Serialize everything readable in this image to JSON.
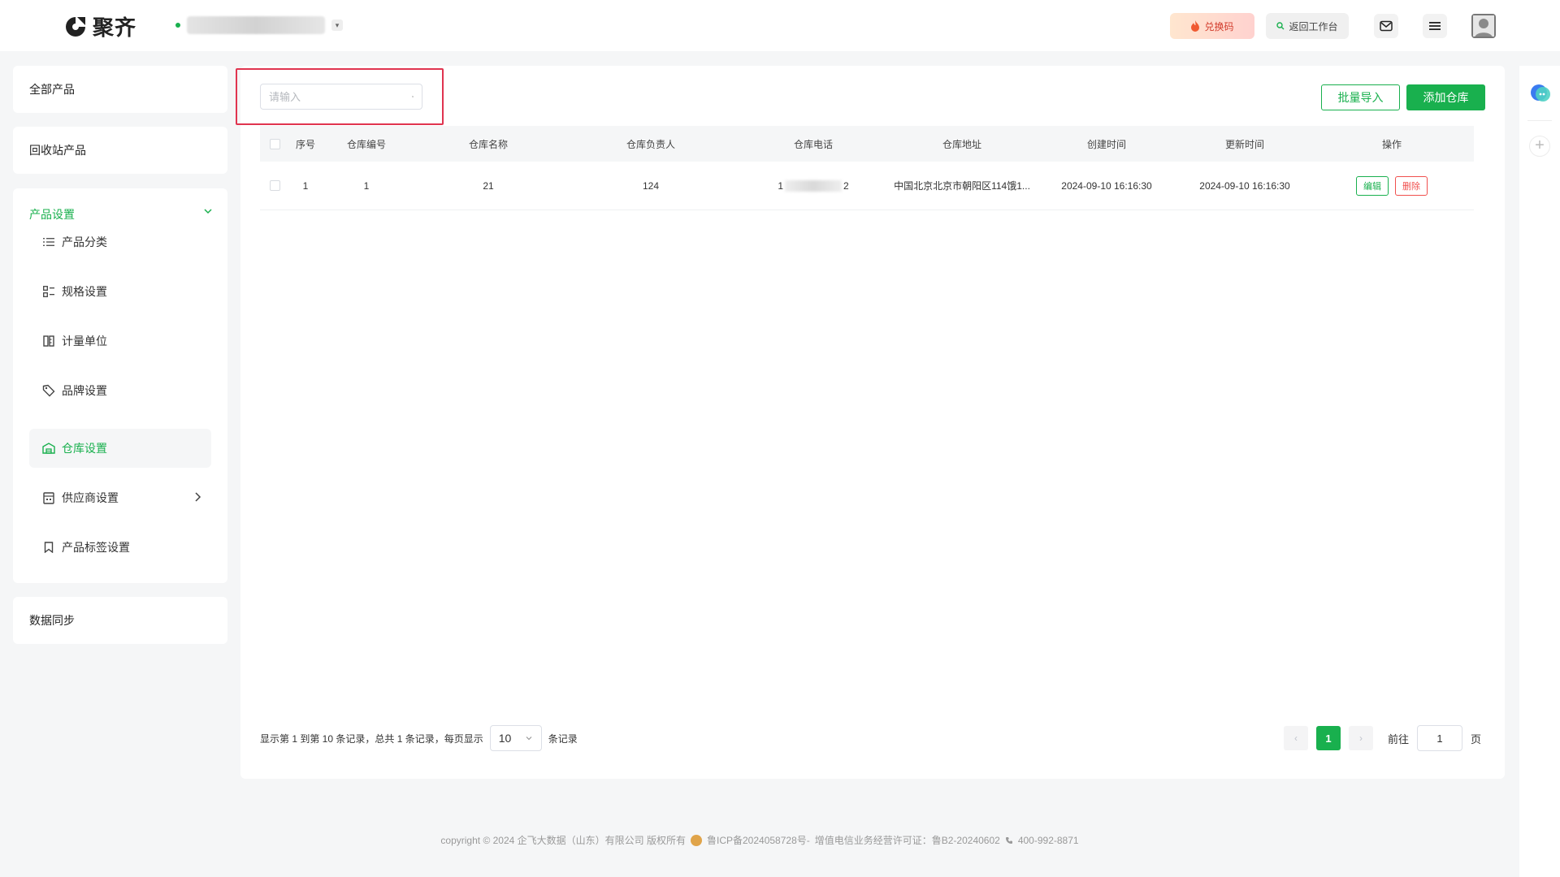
{
  "app": {
    "name": "聚齐",
    "brand_color": "#19b04e"
  },
  "header": {
    "redeem_label": "兑换码",
    "back_label": "返回工作台"
  },
  "sidebar": {
    "all_products": "全部产品",
    "recycle_bin": "回收站产品",
    "group_title": "产品设置",
    "items": [
      {
        "label": "产品分类",
        "icon": "list-icon"
      },
      {
        "label": "规格设置",
        "icon": "spec-grid-icon"
      },
      {
        "label": "计量单位",
        "icon": "ruler-icon"
      },
      {
        "label": "品牌设置",
        "icon": "tag-icon"
      },
      {
        "label": "仓库设置",
        "icon": "warehouse-icon",
        "active": true
      },
      {
        "label": "供应商设置",
        "icon": "supplier-icon"
      },
      {
        "label": "产品标签设置",
        "icon": "bookmark-icon"
      }
    ],
    "data_sync": "数据同步"
  },
  "toolbar": {
    "search_placeholder": "请输入",
    "import_label": "批量导入",
    "add_label": "添加仓库"
  },
  "table": {
    "columns": [
      "序号",
      "仓库编号",
      "仓库名称",
      "仓库负责人",
      "仓库电话",
      "仓库地址",
      "创建时间",
      "更新时间",
      "操作"
    ],
    "rows": [
      {
        "index": "1",
        "code": "1",
        "name": "21",
        "manager": "124",
        "phone_prefix": "1",
        "phone_suffix": "2",
        "address": "中国北京北京市朝阳区114饿1...",
        "created": "2024-09-10 16:16:30",
        "updated": "2024-09-10 16:16:30",
        "edit_label": "编辑",
        "delete_label": "删除"
      }
    ]
  },
  "pagination": {
    "summary": "显示第 1 到第 10 条记录，总共 1 条记录，每页显示",
    "page_size": "10",
    "records_suffix": "条记录",
    "current_page": "1",
    "goto_label": "前往",
    "goto_value": "1",
    "page_suffix": "页"
  },
  "footer": {
    "copyright": "copyright © 2024 企飞大数据（山东）有限公司 版权所有",
    "icp": "鲁ICP备2024058728号-",
    "license": "增值电信业务经营许可证：鲁B2-20240602",
    "phone": "400-992-8871"
  }
}
